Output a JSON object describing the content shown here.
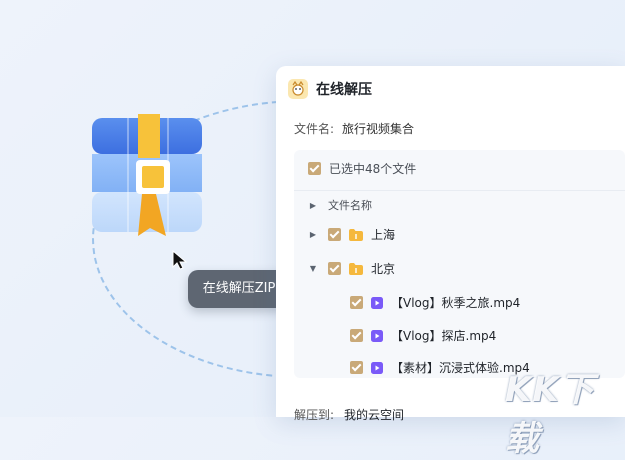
{
  "window": {
    "title": "在线解压"
  },
  "file": {
    "label": "文件名:",
    "name": "旅行视频集合"
  },
  "selection": {
    "summary": "已选中48个文件"
  },
  "list": {
    "column_header": "文件名称",
    "folders": [
      {
        "name": "上海",
        "expanded": false,
        "checked": true
      },
      {
        "name": "北京",
        "expanded": true,
        "checked": true
      }
    ],
    "files": [
      {
        "name": "【Vlog】秋季之旅.mp4",
        "checked": true
      },
      {
        "name": "【Vlog】探店.mp4",
        "checked": true
      },
      {
        "name": "【素材】沉浸式体验.mp4",
        "checked": true
      }
    ]
  },
  "destination": {
    "label": "解压到:",
    "value": "我的云空间"
  },
  "tooltip": {
    "text": "在线解压ZIP"
  },
  "watermark": {
    "text": "KK下载"
  },
  "colors": {
    "checkbox": "#c9a978",
    "folder": "#f5b83d",
    "video": "#7a5af8",
    "tooltip": "#5e6672"
  }
}
